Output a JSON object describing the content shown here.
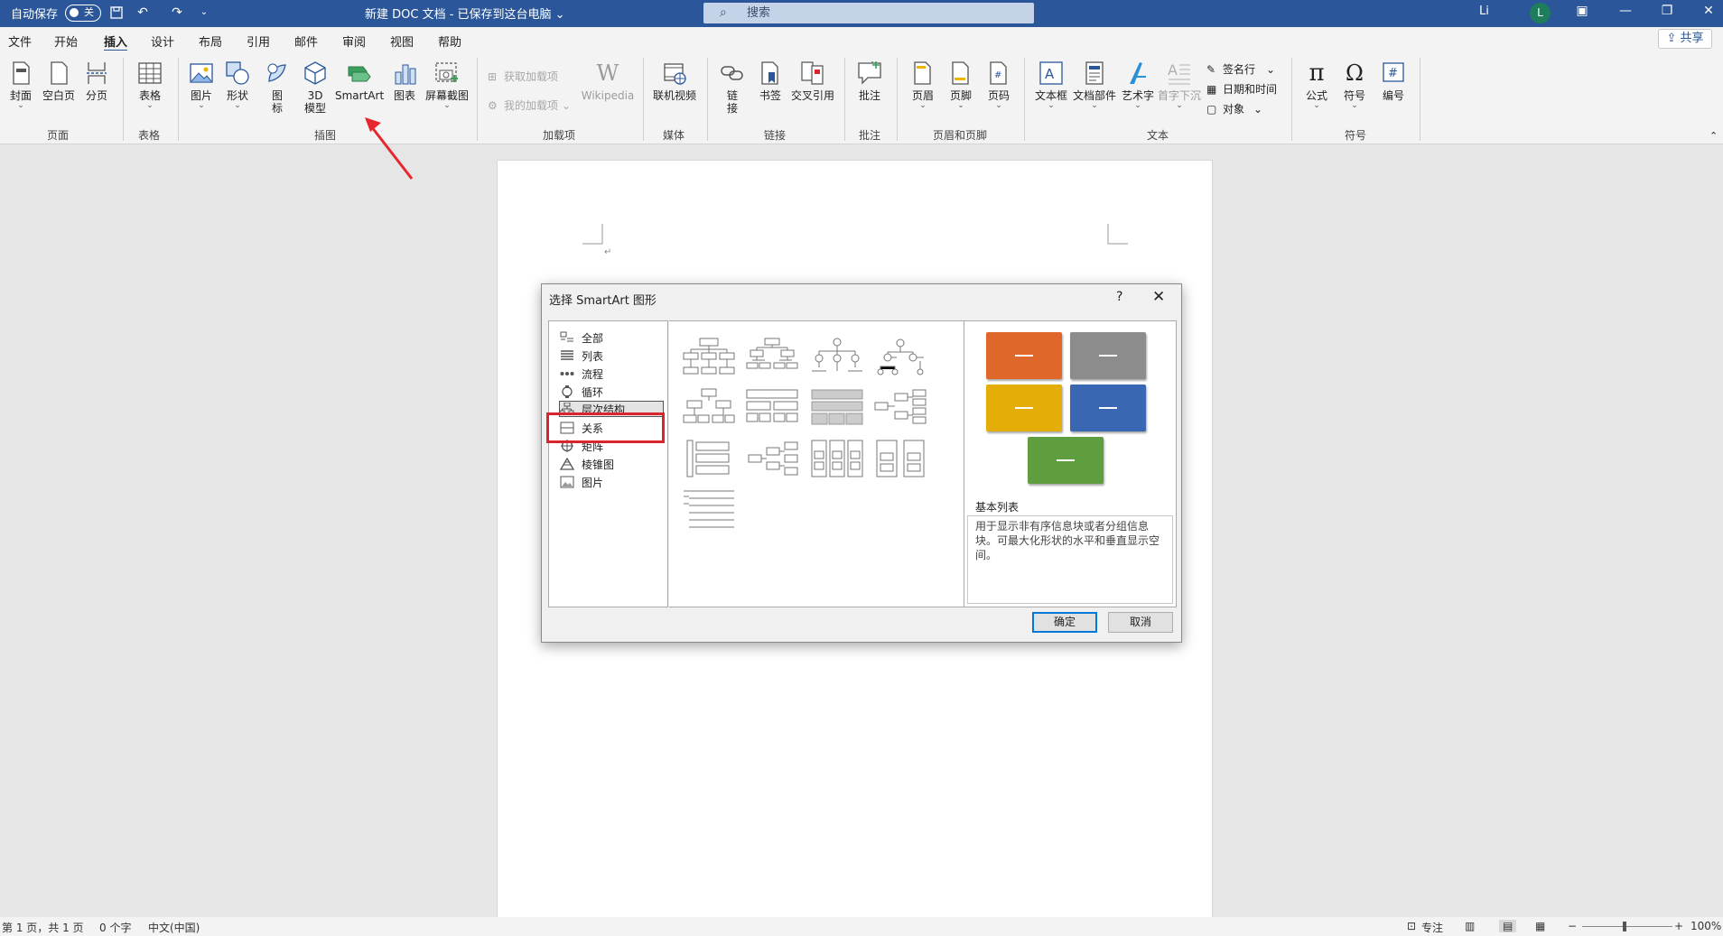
{
  "titlebar": {
    "autosave_label": "自动保存",
    "autosave_state": "关",
    "doc_title": "新建 DOC 文档 - 已保存到这台电脑 ⌄",
    "search_placeholder": "搜索",
    "user_name": "Li",
    "avatar_letter": "L"
  },
  "menu": {
    "tabs": [
      "文件",
      "开始",
      "插入",
      "设计",
      "布局",
      "引用",
      "邮件",
      "审阅",
      "视图",
      "帮助"
    ],
    "active_tab": "插入",
    "share": "共享"
  },
  "ribbon": {
    "groups": {
      "pages": "页面",
      "tables": "表格",
      "illustrations": "插图",
      "addins": "加载项",
      "media": "媒体",
      "links": "链接",
      "comments": "批注",
      "header_footer": "页眉和页脚",
      "text": "文本",
      "symbols": "符号"
    },
    "buttons": {
      "cover": "封面",
      "blank_page": "空白页",
      "page_break": "分页",
      "table": "表格",
      "pictures": "图片",
      "shapes": "形状",
      "icons_1": "图",
      "icons_2": "标",
      "model3d_1": "3D",
      "model3d_2": "模型",
      "smartart": "SmartArt",
      "chart": "图表",
      "screenshot": "屏幕截图",
      "get_addins": "获取加载项",
      "my_addins": "我的加载项",
      "wikipedia": "Wikipedia",
      "online_video": "联机视频",
      "link_1": "链",
      "link_2": "接",
      "bookmark": "书签",
      "cross_ref": "交叉引用",
      "comment": "批注",
      "header": "页眉",
      "footer": "页脚",
      "page_number": "页码",
      "textbox": "文本框",
      "quick_parts": "文档部件",
      "wordart": "艺术字",
      "dropcap": "首字下沉",
      "signature": "签名行",
      "datetime": "日期和时间",
      "object": "对象",
      "equation": "公式",
      "symbol": "符号",
      "numbering": "编号"
    }
  },
  "dialog": {
    "title": "选择 SmartArt 图形",
    "help": "?",
    "close": "✕",
    "categories": [
      "全部",
      "列表",
      "流程",
      "循环",
      "层次结构",
      "关系",
      "矩阵",
      "棱锥图",
      "图片"
    ],
    "selected_category": "层次结构",
    "preview": {
      "name": "基本列表",
      "description": "用于显示非有序信息块或者分组信息块。可最大化形状的水平和垂直显示空间。",
      "colors": [
        "#e0672a",
        "#8c8c8c",
        "#e4ad08",
        "#3a67b1",
        "#5f9e3f"
      ]
    },
    "ok": "确定",
    "cancel": "取消"
  },
  "status": {
    "page": "第 1 页，共 1 页",
    "words": "0 个字",
    "language": "中文(中国)",
    "focus": "专注",
    "zoom": "100%"
  }
}
